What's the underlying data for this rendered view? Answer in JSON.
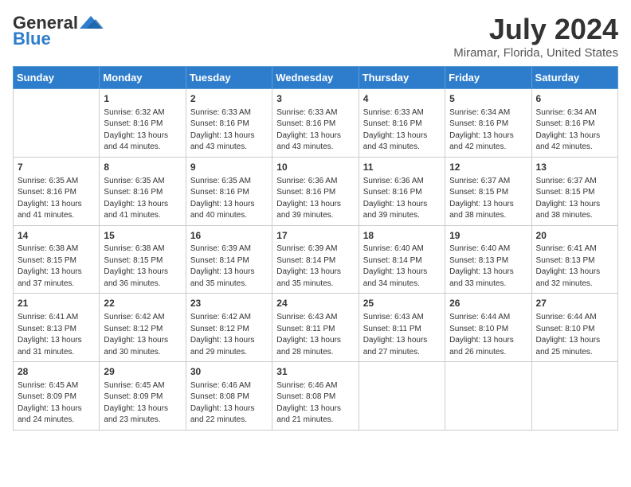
{
  "logo": {
    "general": "General",
    "blue": "Blue"
  },
  "header": {
    "title": "July 2024",
    "subtitle": "Miramar, Florida, United States"
  },
  "days_of_week": [
    "Sunday",
    "Monday",
    "Tuesday",
    "Wednesday",
    "Thursday",
    "Friday",
    "Saturday"
  ],
  "weeks": [
    [
      {
        "day": "",
        "sunrise": "",
        "sunset": "",
        "daylight": ""
      },
      {
        "day": "1",
        "sunrise": "Sunrise: 6:32 AM",
        "sunset": "Sunset: 8:16 PM",
        "daylight": "Daylight: 13 hours and 44 minutes."
      },
      {
        "day": "2",
        "sunrise": "Sunrise: 6:33 AM",
        "sunset": "Sunset: 8:16 PM",
        "daylight": "Daylight: 13 hours and 43 minutes."
      },
      {
        "day": "3",
        "sunrise": "Sunrise: 6:33 AM",
        "sunset": "Sunset: 8:16 PM",
        "daylight": "Daylight: 13 hours and 43 minutes."
      },
      {
        "day": "4",
        "sunrise": "Sunrise: 6:33 AM",
        "sunset": "Sunset: 8:16 PM",
        "daylight": "Daylight: 13 hours and 43 minutes."
      },
      {
        "day": "5",
        "sunrise": "Sunrise: 6:34 AM",
        "sunset": "Sunset: 8:16 PM",
        "daylight": "Daylight: 13 hours and 42 minutes."
      },
      {
        "day": "6",
        "sunrise": "Sunrise: 6:34 AM",
        "sunset": "Sunset: 8:16 PM",
        "daylight": "Daylight: 13 hours and 42 minutes."
      }
    ],
    [
      {
        "day": "7",
        "sunrise": "Sunrise: 6:35 AM",
        "sunset": "Sunset: 8:16 PM",
        "daylight": "Daylight: 13 hours and 41 minutes."
      },
      {
        "day": "8",
        "sunrise": "Sunrise: 6:35 AM",
        "sunset": "Sunset: 8:16 PM",
        "daylight": "Daylight: 13 hours and 41 minutes."
      },
      {
        "day": "9",
        "sunrise": "Sunrise: 6:35 AM",
        "sunset": "Sunset: 8:16 PM",
        "daylight": "Daylight: 13 hours and 40 minutes."
      },
      {
        "day": "10",
        "sunrise": "Sunrise: 6:36 AM",
        "sunset": "Sunset: 8:16 PM",
        "daylight": "Daylight: 13 hours and 39 minutes."
      },
      {
        "day": "11",
        "sunrise": "Sunrise: 6:36 AM",
        "sunset": "Sunset: 8:16 PM",
        "daylight": "Daylight: 13 hours and 39 minutes."
      },
      {
        "day": "12",
        "sunrise": "Sunrise: 6:37 AM",
        "sunset": "Sunset: 8:15 PM",
        "daylight": "Daylight: 13 hours and 38 minutes."
      },
      {
        "day": "13",
        "sunrise": "Sunrise: 6:37 AM",
        "sunset": "Sunset: 8:15 PM",
        "daylight": "Daylight: 13 hours and 38 minutes."
      }
    ],
    [
      {
        "day": "14",
        "sunrise": "Sunrise: 6:38 AM",
        "sunset": "Sunset: 8:15 PM",
        "daylight": "Daylight: 13 hours and 37 minutes."
      },
      {
        "day": "15",
        "sunrise": "Sunrise: 6:38 AM",
        "sunset": "Sunset: 8:15 PM",
        "daylight": "Daylight: 13 hours and 36 minutes."
      },
      {
        "day": "16",
        "sunrise": "Sunrise: 6:39 AM",
        "sunset": "Sunset: 8:14 PM",
        "daylight": "Daylight: 13 hours and 35 minutes."
      },
      {
        "day": "17",
        "sunrise": "Sunrise: 6:39 AM",
        "sunset": "Sunset: 8:14 PM",
        "daylight": "Daylight: 13 hours and 35 minutes."
      },
      {
        "day": "18",
        "sunrise": "Sunrise: 6:40 AM",
        "sunset": "Sunset: 8:14 PM",
        "daylight": "Daylight: 13 hours and 34 minutes."
      },
      {
        "day": "19",
        "sunrise": "Sunrise: 6:40 AM",
        "sunset": "Sunset: 8:13 PM",
        "daylight": "Daylight: 13 hours and 33 minutes."
      },
      {
        "day": "20",
        "sunrise": "Sunrise: 6:41 AM",
        "sunset": "Sunset: 8:13 PM",
        "daylight": "Daylight: 13 hours and 32 minutes."
      }
    ],
    [
      {
        "day": "21",
        "sunrise": "Sunrise: 6:41 AM",
        "sunset": "Sunset: 8:13 PM",
        "daylight": "Daylight: 13 hours and 31 minutes."
      },
      {
        "day": "22",
        "sunrise": "Sunrise: 6:42 AM",
        "sunset": "Sunset: 8:12 PM",
        "daylight": "Daylight: 13 hours and 30 minutes."
      },
      {
        "day": "23",
        "sunrise": "Sunrise: 6:42 AM",
        "sunset": "Sunset: 8:12 PM",
        "daylight": "Daylight: 13 hours and 29 minutes."
      },
      {
        "day": "24",
        "sunrise": "Sunrise: 6:43 AM",
        "sunset": "Sunset: 8:11 PM",
        "daylight": "Daylight: 13 hours and 28 minutes."
      },
      {
        "day": "25",
        "sunrise": "Sunrise: 6:43 AM",
        "sunset": "Sunset: 8:11 PM",
        "daylight": "Daylight: 13 hours and 27 minutes."
      },
      {
        "day": "26",
        "sunrise": "Sunrise: 6:44 AM",
        "sunset": "Sunset: 8:10 PM",
        "daylight": "Daylight: 13 hours and 26 minutes."
      },
      {
        "day": "27",
        "sunrise": "Sunrise: 6:44 AM",
        "sunset": "Sunset: 8:10 PM",
        "daylight": "Daylight: 13 hours and 25 minutes."
      }
    ],
    [
      {
        "day": "28",
        "sunrise": "Sunrise: 6:45 AM",
        "sunset": "Sunset: 8:09 PM",
        "daylight": "Daylight: 13 hours and 24 minutes."
      },
      {
        "day": "29",
        "sunrise": "Sunrise: 6:45 AM",
        "sunset": "Sunset: 8:09 PM",
        "daylight": "Daylight: 13 hours and 23 minutes."
      },
      {
        "day": "30",
        "sunrise": "Sunrise: 6:46 AM",
        "sunset": "Sunset: 8:08 PM",
        "daylight": "Daylight: 13 hours and 22 minutes."
      },
      {
        "day": "31",
        "sunrise": "Sunrise: 6:46 AM",
        "sunset": "Sunset: 8:08 PM",
        "daylight": "Daylight: 13 hours and 21 minutes."
      },
      {
        "day": "",
        "sunrise": "",
        "sunset": "",
        "daylight": ""
      },
      {
        "day": "",
        "sunrise": "",
        "sunset": "",
        "daylight": ""
      },
      {
        "day": "",
        "sunrise": "",
        "sunset": "",
        "daylight": ""
      }
    ]
  ]
}
